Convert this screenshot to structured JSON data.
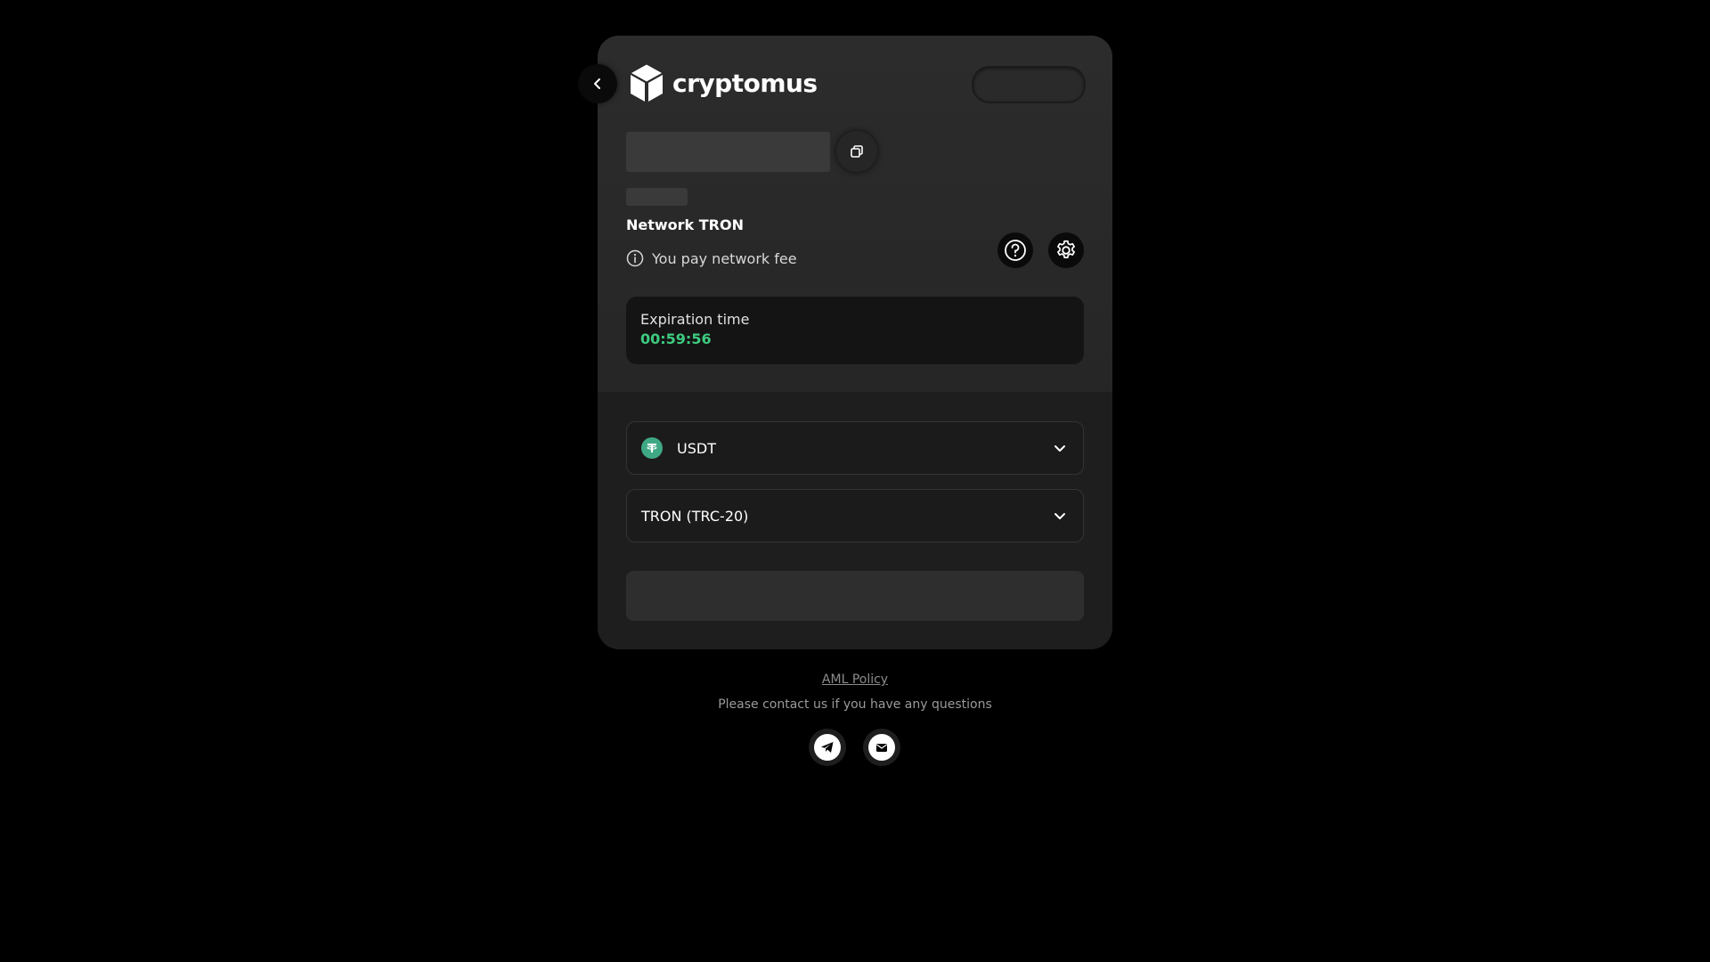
{
  "header": {
    "logo_text": "cryptomus",
    "back_icon": "chevron-left-icon",
    "logo_icon": "cube-icon"
  },
  "payment": {
    "network_title": "Network TRON",
    "fee_note": "You pay network fee",
    "expiration_label": "Expiration time",
    "expiration_time": "00:59:56",
    "expiration_color": "#3ecb80"
  },
  "selectors": {
    "currency": "USDT",
    "network": "TRON (TRC-20)"
  },
  "footer": {
    "aml_policy": "AML Policy",
    "contact_text": "Please contact us if you have any questions"
  },
  "colors": {
    "background": "#000000",
    "card": "#1e1e1e",
    "accent_green": "#3ecb80",
    "usdt": "#3fa884"
  }
}
